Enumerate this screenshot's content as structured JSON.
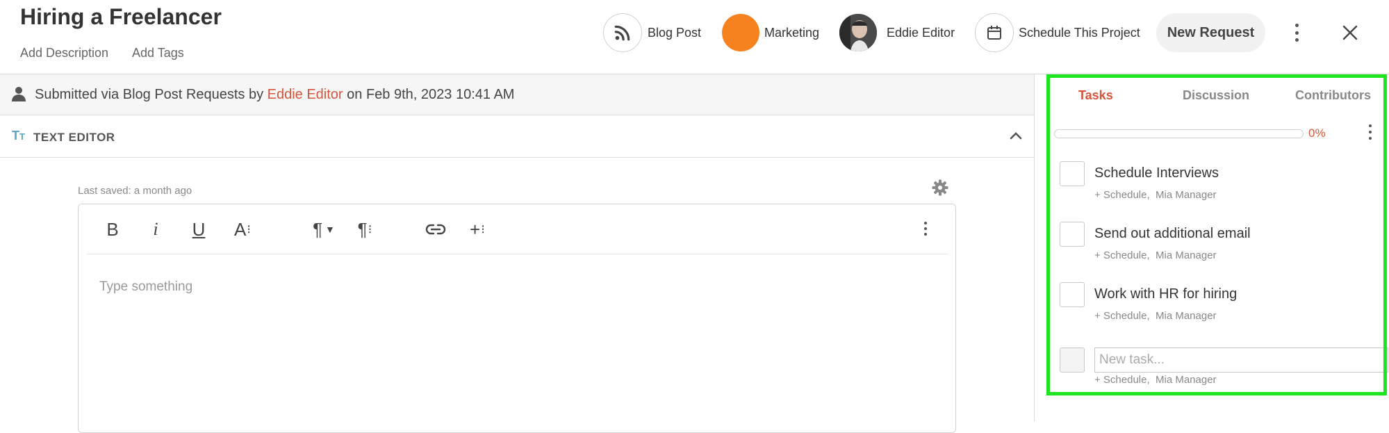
{
  "header": {
    "title": "Hiring a Freelancer",
    "add_description": "Add Description",
    "add_tags": "Add Tags",
    "blog_post": "Blog Post",
    "marketing": "Marketing",
    "marketing_color": "#f5821f",
    "assignee": "Eddie Editor",
    "schedule": "Schedule This Project",
    "new_request": "New Request"
  },
  "submitted": {
    "prefix": "Submitted via Blog Post Requests by",
    "user": "Eddie Editor",
    "suffix": "on Feb 9th, 2023 10:41 AM"
  },
  "editor": {
    "section_label": "TEXT EDITOR",
    "last_saved": "Last saved: a month ago",
    "placeholder": "Type something",
    "toolbar": {
      "bold": "B",
      "italic": "i",
      "underline": "U",
      "font": "A",
      "paragraph": "¶",
      "paragraph2": "¶",
      "insert": "+"
    }
  },
  "panel": {
    "tabs": [
      {
        "label": "Tasks",
        "active": true
      },
      {
        "label": "Discussion",
        "active": false
      },
      {
        "label": "Contributors",
        "active": false
      }
    ],
    "progress": "0%",
    "progress_value": 0,
    "tasks": [
      {
        "name": "Schedule Interviews",
        "schedule": "+ Schedule,",
        "assignee": "Mia Manager"
      },
      {
        "name": "Send out additional email",
        "schedule": "+ Schedule,",
        "assignee": "Mia Manager"
      },
      {
        "name": "Work with HR for hiring",
        "schedule": "+ Schedule,",
        "assignee": "Mia Manager"
      }
    ],
    "new_task": {
      "placeholder": "New task...",
      "schedule": "+ Schedule,",
      "assignee": "Mia Manager"
    }
  },
  "colors": {
    "accent": "#d4553a",
    "highlight": "#1ee61e",
    "active_tab": "#d4553a"
  }
}
